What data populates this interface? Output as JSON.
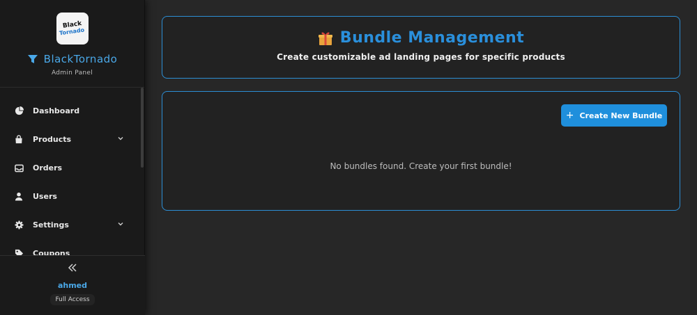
{
  "brand": {
    "logo_line1": "Black",
    "logo_line2": "Tornado",
    "name": "BlackTornado",
    "subtitle": "Admin Panel"
  },
  "nav": {
    "items": [
      {
        "label": "Dashboard",
        "icon": "pie-chart-icon"
      },
      {
        "label": "Products",
        "icon": "shopping-bag-icon",
        "has_submenu": true
      },
      {
        "label": "Orders",
        "icon": "inbox-icon"
      },
      {
        "label": "Users",
        "icon": "user-icon"
      },
      {
        "label": "Settings",
        "icon": "gear-icon",
        "has_submenu": true
      },
      {
        "label": "Coupons",
        "icon": "tag-icon"
      }
    ]
  },
  "footer": {
    "user_name": "ahmed",
    "access_level": "Full Access"
  },
  "header": {
    "title": "Bundle Management",
    "subtitle": "Create customizable ad landing pages for specific products"
  },
  "main": {
    "create_button_label": "Create New Bundle",
    "empty_message": "No bundles found. Create your first bundle!"
  },
  "colors": {
    "accent": "#2a8fdb",
    "background": "#272727",
    "sidebar": "#1a1a1a"
  }
}
